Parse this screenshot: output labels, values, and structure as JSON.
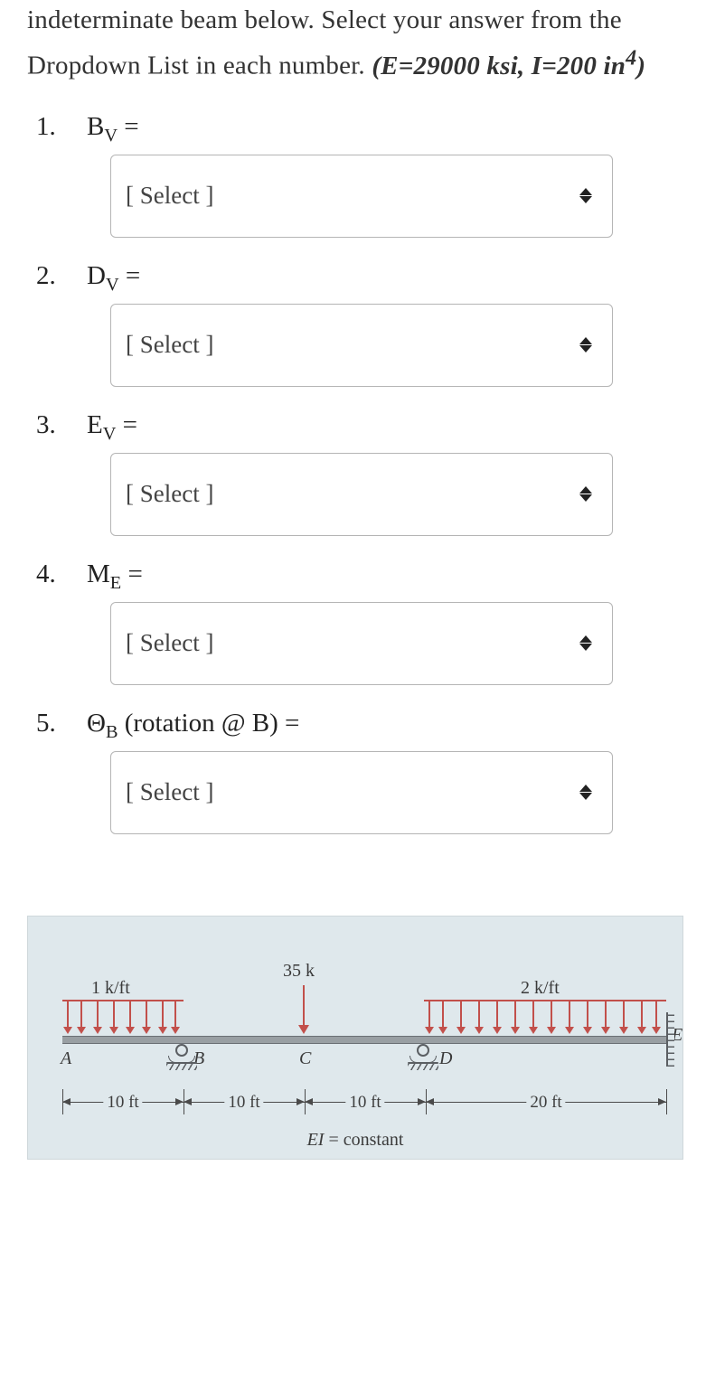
{
  "intro": {
    "line1": "indeterminate beam below. Select your",
    "line2": "answer from the Dropdown List in each",
    "line3_prefix": "number. ",
    "given_html": "(E=29000 ksi, I=200 in"
  },
  "questions": [
    {
      "var": "B",
      "sub": "V",
      "suffix": " =",
      "placeholder": "[ Select ]"
    },
    {
      "var": "D",
      "sub": "V",
      "suffix": " =",
      "placeholder": "[ Select ]"
    },
    {
      "var": "E",
      "sub": "V",
      "suffix": " =",
      "placeholder": "[ Select ]"
    },
    {
      "var": "M",
      "sub": "E",
      "suffix": " =",
      "placeholder": "[ Select ]"
    },
    {
      "var": "Θ",
      "sub": "B",
      "suffix": " (rotation @ B) =",
      "placeholder": "[ Select ]"
    }
  ],
  "diagram": {
    "load_left": "1 k/ft",
    "point_load": "35 k",
    "load_right": "2 k/ft",
    "points": {
      "A": "A",
      "B": "B",
      "C": "C",
      "D": "D",
      "E": "E"
    },
    "spans": [
      "10 ft",
      "10 ft",
      "10 ft",
      "20 ft"
    ],
    "ei": "EI = constant",
    "span_lengths_ft": [
      10,
      10,
      10,
      20
    ],
    "E_ksi": 29000,
    "I_in4": 200
  }
}
